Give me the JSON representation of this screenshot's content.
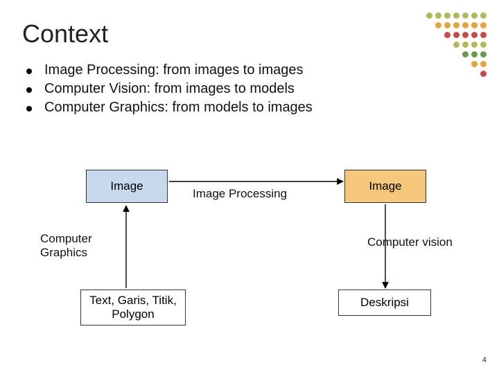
{
  "title": "Context",
  "bullets": [
    "Image Processing: from images to images",
    "Computer Vision: from images to models",
    "Computer Graphics: from models to images"
  ],
  "diagram": {
    "box_image_left": "Image",
    "box_image_right": "Image",
    "label_image_processing": "Image Processing",
    "label_computer_graphics": "Computer\nGraphics",
    "label_computer_vision": "Computer vision",
    "box_text_bottom_left": "Text, Garis, Titik,\nPolygon",
    "box_deskripsi": "Deskripsi"
  },
  "page_number": "4",
  "decoration_colors": {
    "olive": "#b0ba5a",
    "orange": "#e8a23a",
    "red": "#c54a4a",
    "green": "#6a9a4a"
  }
}
